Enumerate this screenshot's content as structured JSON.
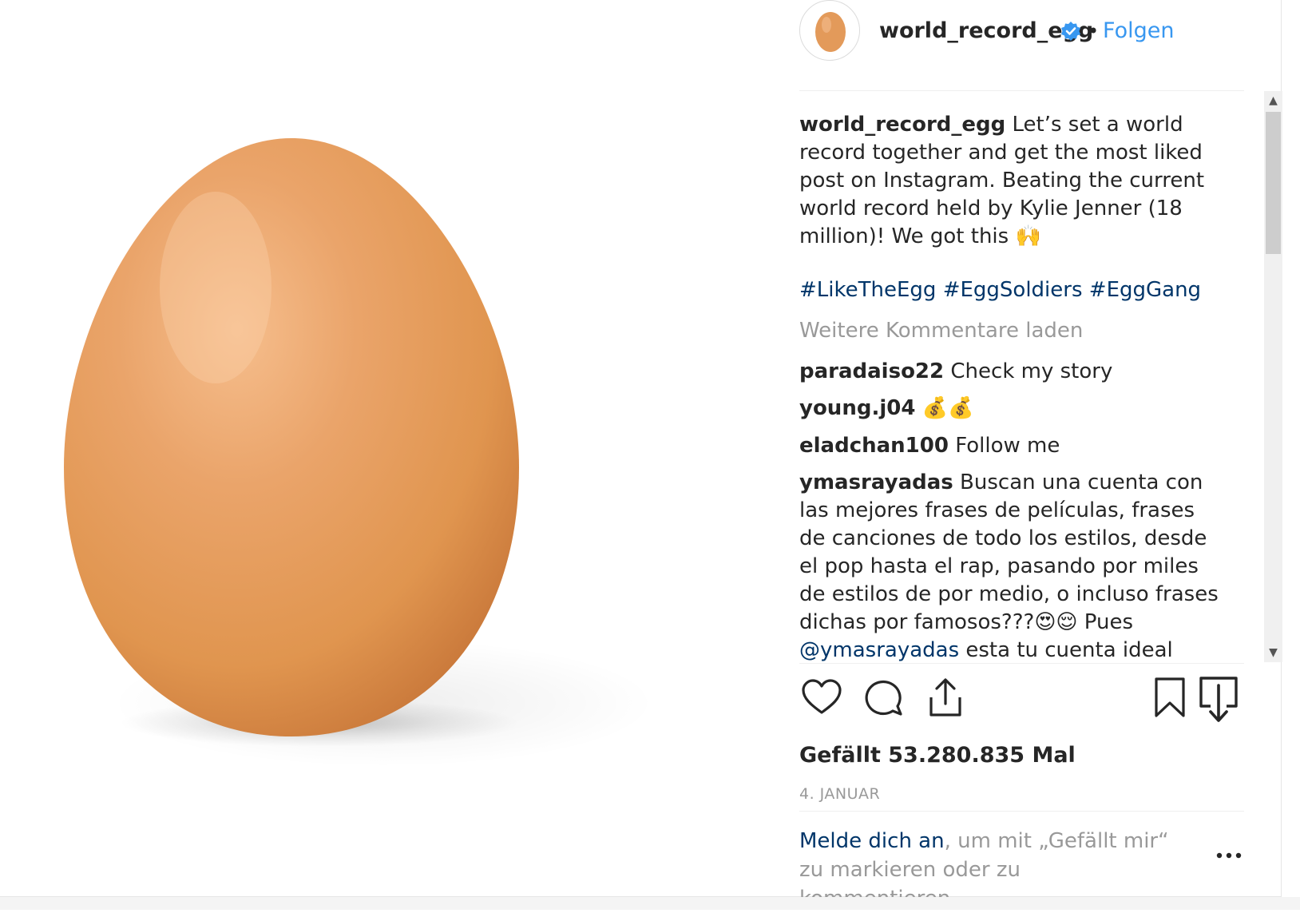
{
  "post": {
    "username": "world_record_egg",
    "follow_label": "Folgen",
    "separator": "•",
    "caption": {
      "user": "world_record_egg",
      "text": "Let’s set a world record together and get the most liked post on Instagram. Beating the current world record held by Kylie Jenner (18 million)! We got this 🙌"
    },
    "hashtags": [
      "#LikeTheEgg",
      "#EggSoldiers",
      "#EggGang"
    ],
    "load_more_label": "Weitere Kommentare laden",
    "comments": [
      {
        "user": "paradaiso22",
        "text": "Check my story"
      },
      {
        "user": "young.j04",
        "text": "💰💰"
      },
      {
        "user": "eladchan100",
        "text": "Follow me"
      },
      {
        "user": "ymasrayadas",
        "text_before": "Buscan una cuenta con las mejores frases de películas, frases de canciones de todo los estilos, desde el pop hasta el rap, pasando por miles de estilos de por medio, o incluso frases dichas por famosos???😍😌 Pues",
        "mention": "@ymasrayadas",
        "text_after": "esta tu cuenta ideal siguenos y te seguiremos de"
      }
    ],
    "likes_text": "Gefällt 53.280.835 Mal",
    "date": "4. JANUAR",
    "login_link": "Melde dich an",
    "login_rest": ", um mit „Gefällt mir“ zu markieren oder zu kommentieren."
  },
  "icons": {
    "like": "heart-outline-icon",
    "comment": "speech-bubble-icon",
    "share": "share-upload-icon",
    "save": "bookmark-icon",
    "download": "download-icon",
    "more": "more-dots-icon",
    "verified": "verified-badge-icon"
  },
  "colors": {
    "link_blue": "#3897f0",
    "hashtag_navy": "#003569",
    "muted_gray": "#999999",
    "text": "#262626",
    "verified": "#3897f0",
    "egg": "#e39a5a"
  }
}
